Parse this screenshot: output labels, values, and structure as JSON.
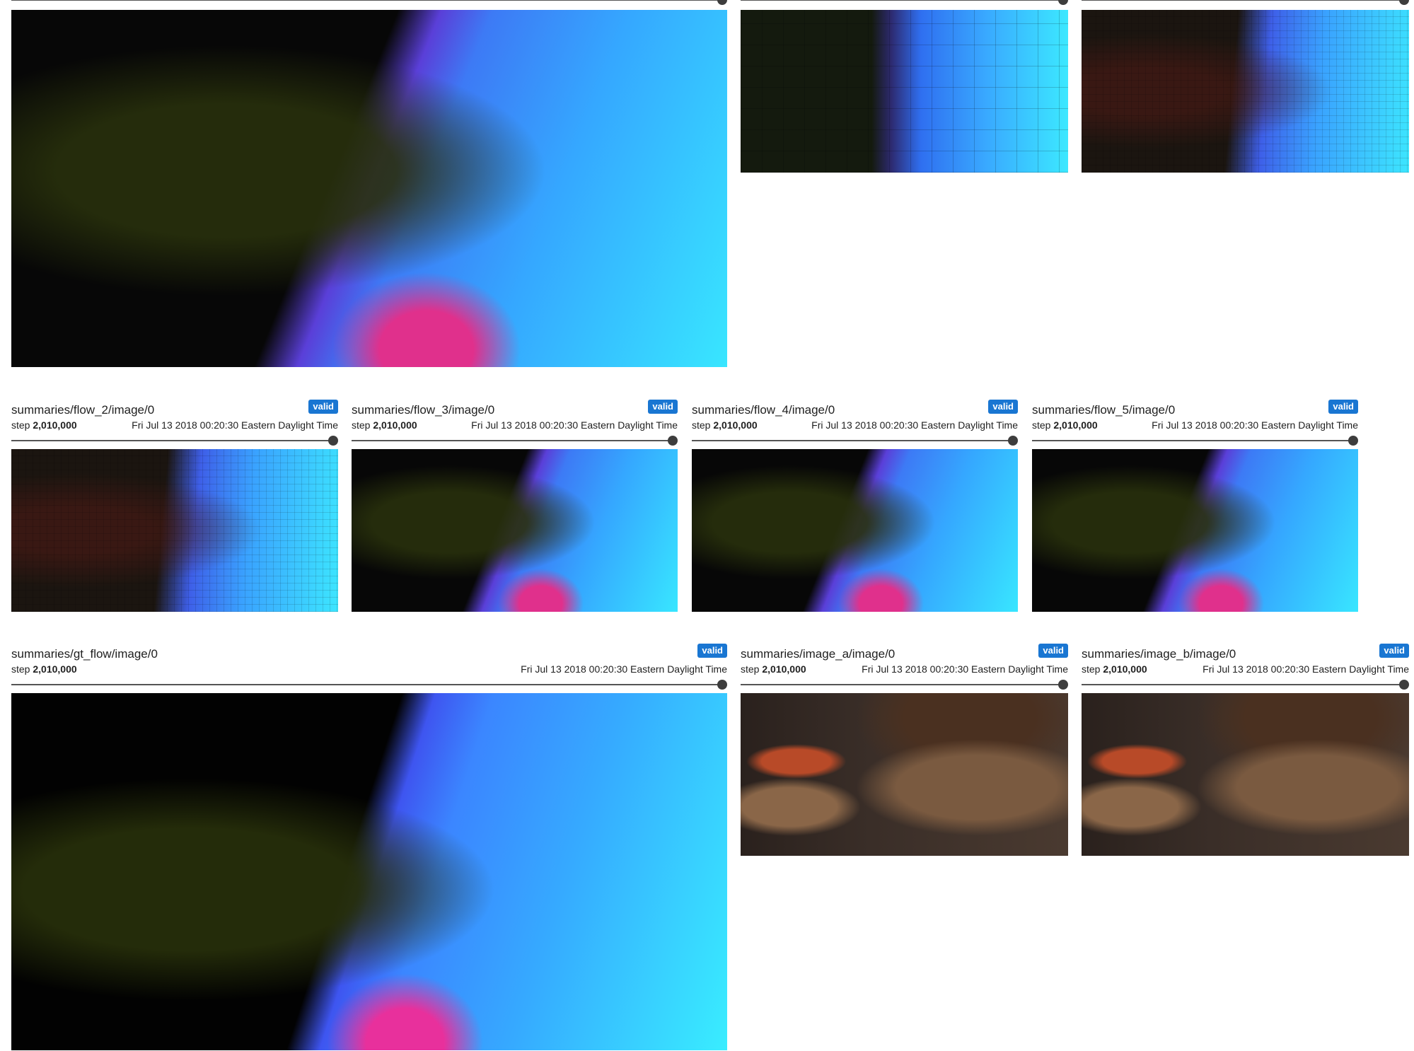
{
  "common": {
    "valid_label": "valid",
    "step_label": "step",
    "step_value": "2,010,000",
    "timestamp": "Fri Jul 13 2018 00:20:30 Eastern Daylight Time"
  },
  "cards": [
    {
      "title": "summaries/flow_2/image/0"
    },
    {
      "title": "summaries/flow_3/image/0"
    },
    {
      "title": "summaries/flow_4/image/0"
    },
    {
      "title": "summaries/flow_5/image/0"
    },
    {
      "title": "summaries/gt_flow/image/0"
    },
    {
      "title": "summaries/image_a/image/0"
    },
    {
      "title": "summaries/image_b/image/0"
    }
  ]
}
